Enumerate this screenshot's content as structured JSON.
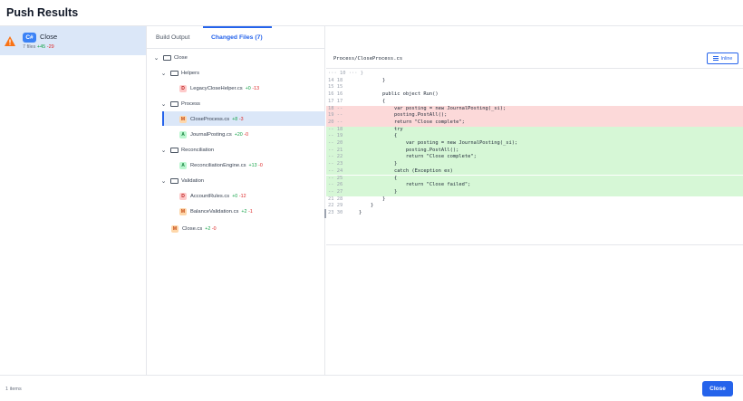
{
  "header": {
    "title": "Push Results"
  },
  "push": {
    "lang": "C#",
    "name": "Close",
    "files": "7 files",
    "additions": "+45",
    "deletions": "-29",
    "warning_icon": "warning-triangle-icon"
  },
  "tabs": {
    "build": "Build Output",
    "changed": "Changed Files (7)"
  },
  "tree": {
    "root": "Close",
    "helpers": "Helpers",
    "legacy": {
      "status": "D",
      "name": "LegacyCloseHelper.cs",
      "add": "+0",
      "del": "-13"
    },
    "process": "Process",
    "closeprocess": {
      "status": "M",
      "name": "CloseProcess.cs",
      "add": "+8",
      "del": "-3"
    },
    "journal": {
      "status": "A",
      "name": "JournalPosting.cs",
      "add": "+20",
      "del": "-0"
    },
    "reconciliation": "Reconciliation",
    "reconengine": {
      "status": "A",
      "name": "ReconciliationEngine.cs",
      "add": "+13",
      "del": "-0"
    },
    "validation": "Validation",
    "accountrules": {
      "status": "D",
      "name": "AccountRules.cs",
      "add": "+0",
      "del": "-12"
    },
    "balance": {
      "status": "M",
      "name": "BalanceValidation.cs",
      "add": "+2",
      "del": "-1"
    },
    "closecs": {
      "status": "M",
      "name": "Close.cs",
      "add": "+2",
      "del": "-0"
    }
  },
  "diff": {
    "path": "Process/CloseProcess.cs",
    "inline_label": "Inline",
    "lines": [
      {
        "kind": "hunk",
        "no": "",
        "text": "··· 10 ··· }"
      },
      {
        "kind": "ctx",
        "no": "14 18",
        "text": "        }"
      },
      {
        "kind": "ctx",
        "no": "15 15",
        "text": ""
      },
      {
        "kind": "ctx",
        "no": "16 16",
        "text": "        public object Run()"
      },
      {
        "kind": "ctx",
        "no": "17 17",
        "text": "        {"
      },
      {
        "kind": "del",
        "no": "18 --",
        "text": "            var posting = new JournalPosting(_si);"
      },
      {
        "kind": "del",
        "no": "19 --",
        "text": "            posting.PostAll();"
      },
      {
        "kind": "del",
        "no": "20 --",
        "text": "            return \"Close complete\";"
      },
      {
        "kind": "add",
        "no": "-- 18",
        "text": "            try"
      },
      {
        "kind": "add",
        "no": "-- 19",
        "text": "            {"
      },
      {
        "kind": "add",
        "no": "-- 20",
        "text": "                var posting = new JournalPosting(_si);"
      },
      {
        "kind": "add",
        "no": "-- 21",
        "text": "                posting.PostAll();"
      },
      {
        "kind": "add",
        "no": "-- 22",
        "text": "                return \"Close complete\";"
      },
      {
        "kind": "add",
        "no": "-- 23",
        "text": "            }"
      },
      {
        "kind": "add",
        "no": "-- 24",
        "text": "            catch (Exception ex)"
      },
      {
        "kind": "add",
        "no": "-- 25",
        "text": "            {"
      },
      {
        "kind": "add",
        "no": "-- 26",
        "text": "                return \"Close failed\";"
      },
      {
        "kind": "add",
        "no": "-- 27",
        "text": "            }"
      },
      {
        "kind": "ctx",
        "no": "21 28",
        "text": "        }"
      },
      {
        "kind": "ctx",
        "no": "22 29",
        "text": "    }"
      },
      {
        "kind": "ctx",
        "no": "23 30",
        "text": "}"
      }
    ]
  },
  "footer": {
    "count": "1 items",
    "close": "Close"
  }
}
